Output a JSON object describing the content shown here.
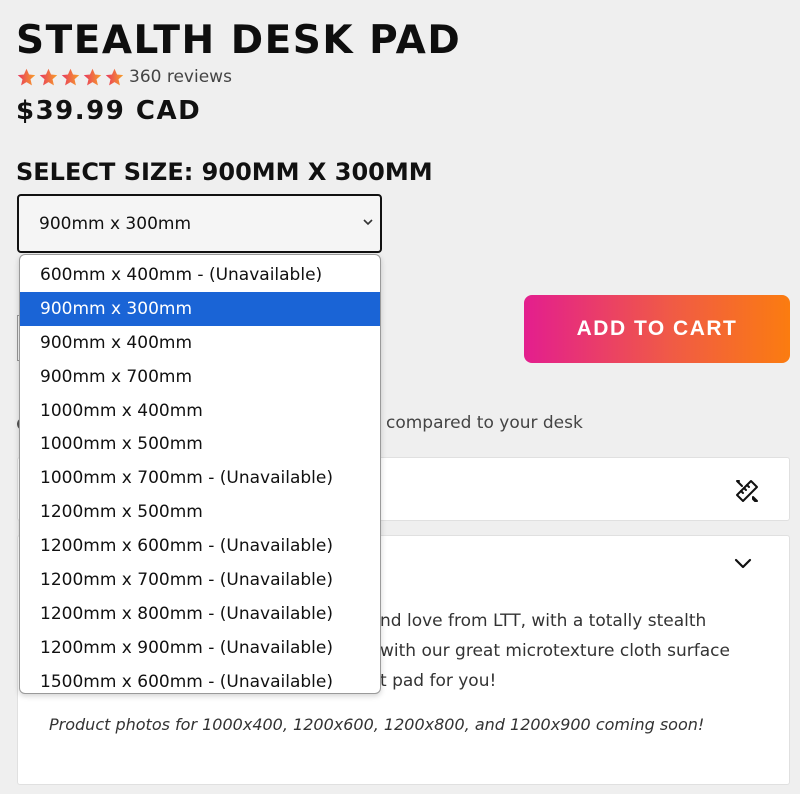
{
  "product": {
    "title": "STEALTH DESK PAD",
    "rating_stars": 5,
    "reviews": "360 reviews",
    "price": "$39.99 CAD"
  },
  "size_selector": {
    "label": "SELECT SIZE: 900MM X 300MM",
    "current_value": "900mm x 300mm",
    "options": [
      {
        "label": "600mm x 400mm - (Unavailable)",
        "selected": false
      },
      {
        "label": "900mm x 300mm",
        "selected": true
      },
      {
        "label": "900mm x 400mm",
        "selected": false
      },
      {
        "label": "900mm x 700mm",
        "selected": false
      },
      {
        "label": "1000mm x 400mm",
        "selected": false
      },
      {
        "label": "1000mm x 500mm",
        "selected": false
      },
      {
        "label": "1000mm x 700mm - (Unavailable)",
        "selected": false
      },
      {
        "label": "1200mm x 500mm",
        "selected": false
      },
      {
        "label": "1200mm x 600mm - (Unavailable)",
        "selected": false
      },
      {
        "label": "1200mm x 700mm - (Unavailable)",
        "selected": false
      },
      {
        "label": "1200mm x 800mm - (Unavailable)",
        "selected": false
      },
      {
        "label": "1200mm x 900mm - (Unavailable)",
        "selected": false
      },
      {
        "label": "1500mm x 600mm - (Unavailable)",
        "selected": false
      }
    ]
  },
  "cart": {
    "add_label": "ADD TO CART"
  },
  "compare": {
    "text": "compared to your desk"
  },
  "description": {
    "line1": "nd love from LTT, with a totally stealth",
    "line2": "with our great microtexture cloth surface",
    "line3": "t pad for you!",
    "note": "Product photos for 1000x400, 1200x600, 1200x800, and 1200x900 coming soon!"
  },
  "colors": {
    "accent_start": "#e31e8e",
    "accent_end": "#fb7c10",
    "selected_option": "#1a64d6",
    "star_gradient_start": "#e8385e",
    "star_gradient_end": "#f7a02a"
  },
  "icons": {
    "stars": "star-icon",
    "select_chevron": "chevron-down-icon",
    "measure": "ruler-pencil-icon",
    "accordion": "chevron-down-icon"
  }
}
